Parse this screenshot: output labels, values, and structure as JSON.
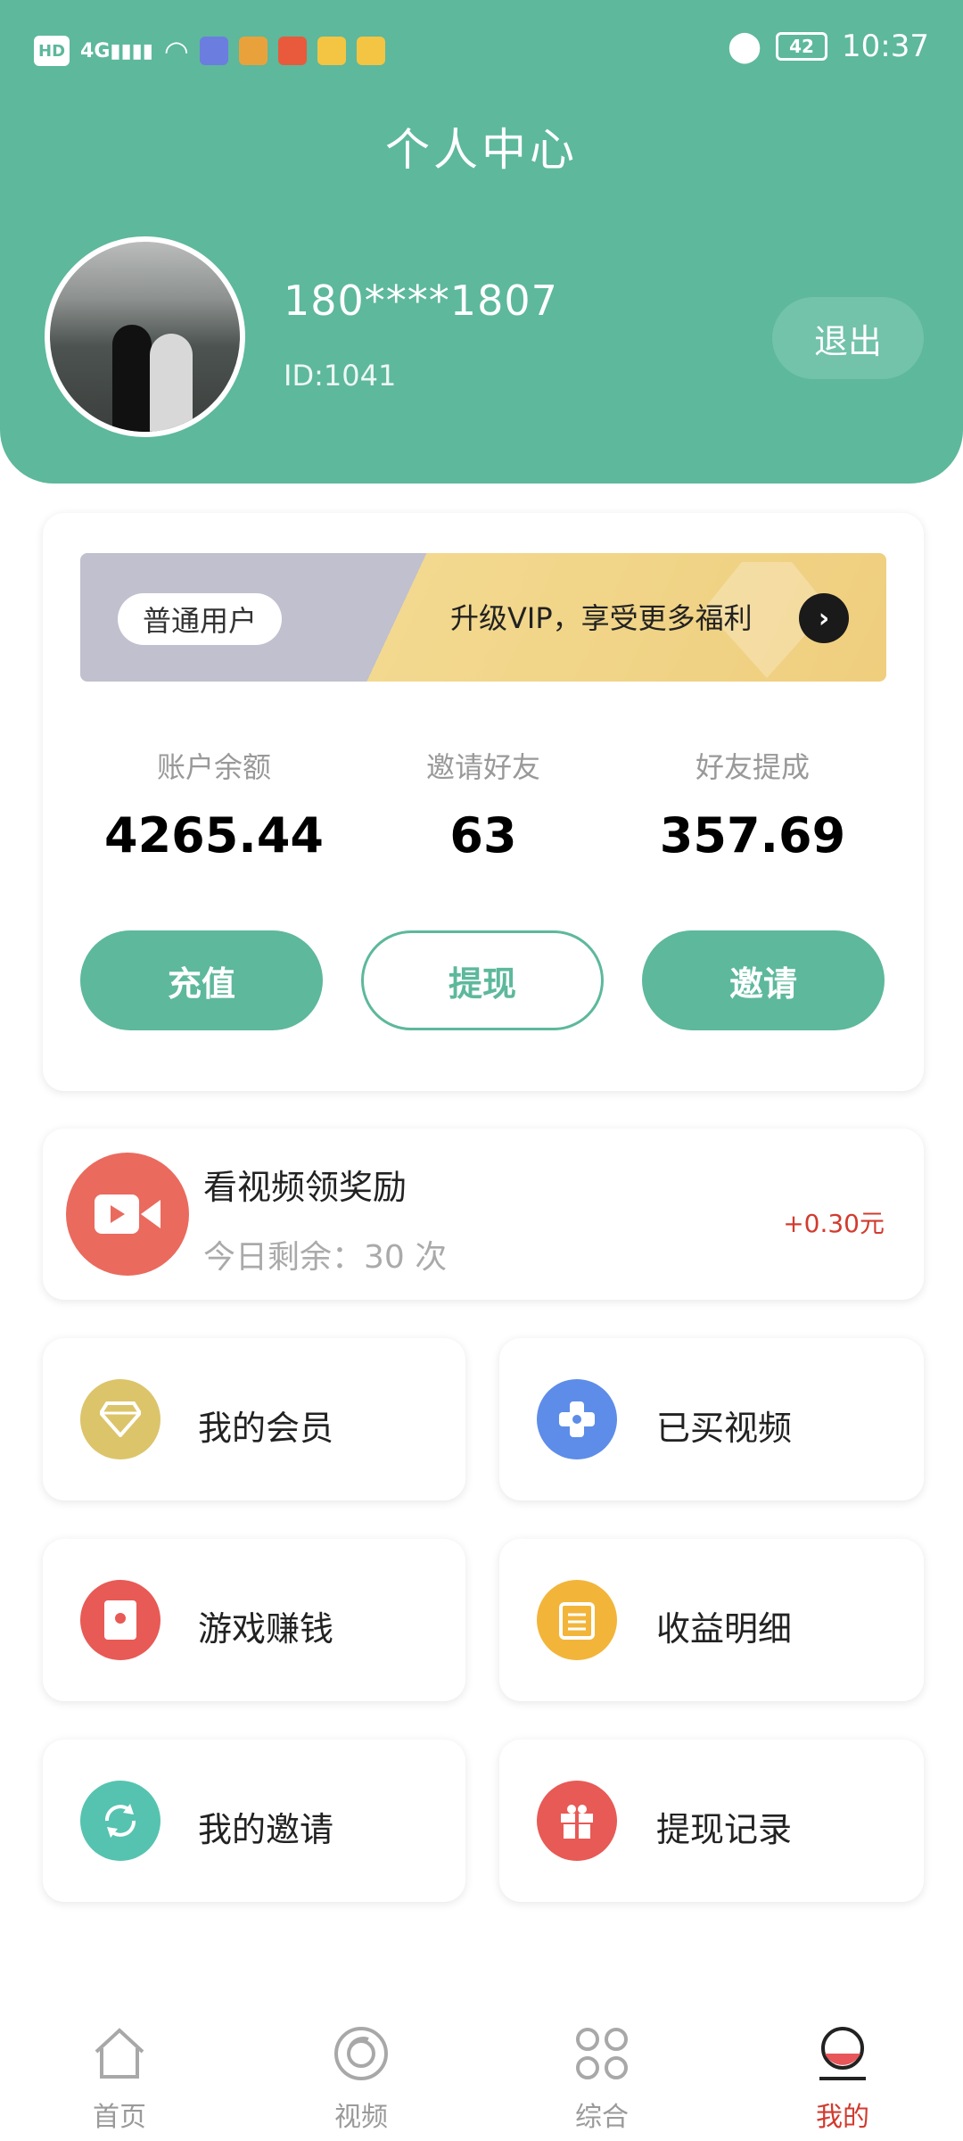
{
  "status_bar": {
    "hd": "HD",
    "network": "4G",
    "battery": "42",
    "time": "10:37"
  },
  "header": {
    "title": "个人中心",
    "phone": "180****1807",
    "user_id": "ID:1041",
    "logout_label": "退出"
  },
  "vip": {
    "level": "普通用户",
    "upgrade_text": "升级VIP，享受更多福利"
  },
  "stats": [
    {
      "label": "账户余额",
      "value": "4265.44"
    },
    {
      "label": "邀请好友",
      "value": "63"
    },
    {
      "label": "好友提成",
      "value": "357.69"
    }
  ],
  "actions": {
    "recharge": "充值",
    "withdraw": "提现",
    "invite": "邀请"
  },
  "video_reward": {
    "title": "看视频领奖励",
    "remaining": "今日剩余：30 次",
    "reward": "+0.30元"
  },
  "menu": [
    {
      "label": "我的会员",
      "icon": "diamond-icon",
      "color": "#dcc46a"
    },
    {
      "label": "已买视频",
      "icon": "gamepad-icon",
      "color": "#5d8de8"
    },
    {
      "label": "游戏赚钱",
      "icon": "red-envelope-icon",
      "color": "#e85a55"
    },
    {
      "label": "收益明细",
      "icon": "clipboard-icon",
      "color": "#f2b53a"
    },
    {
      "label": "我的邀请",
      "icon": "refresh-icon",
      "color": "#55c3b0"
    },
    {
      "label": "提现记录",
      "icon": "gift-icon",
      "color": "#e85a55"
    }
  ],
  "tabs": [
    {
      "label": "首页",
      "icon": "home-icon"
    },
    {
      "label": "视频",
      "icon": "video-ring-icon"
    },
    {
      "label": "综合",
      "icon": "grid-icon"
    },
    {
      "label": "我的",
      "icon": "profile-icon",
      "active": true
    }
  ],
  "colors": {
    "primary": "#5db89c",
    "accent_red": "#d23b2f"
  }
}
